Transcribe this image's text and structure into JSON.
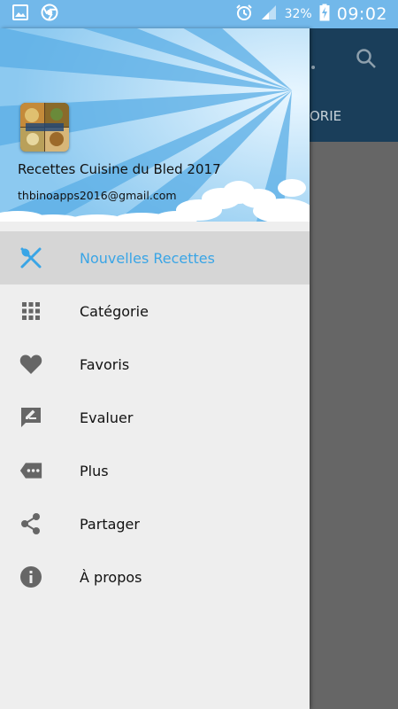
{
  "status_bar": {
    "battery_percent": "32%",
    "time": "09:02",
    "icons": [
      "image-icon",
      "chrome-icon",
      "alarm-icon",
      "signal-icon",
      "battery-charging-icon"
    ]
  },
  "background_app": {
    "tab_fragment": "ORIE"
  },
  "drawer": {
    "header": {
      "app_name": "Recettes Cuisine du Bled 2017",
      "email": "thbinoapps2016@gmail.com"
    },
    "items": [
      {
        "label": "Nouvelles Recettes",
        "icon": "fork-spoon-icon",
        "active": true
      },
      {
        "label": "Catégorie",
        "icon": "grid-icon",
        "active": false
      },
      {
        "label": "Favoris",
        "icon": "heart-icon",
        "active": false
      },
      {
        "label": "Evaluer",
        "icon": "rate-review-icon",
        "active": false
      },
      {
        "label": "Plus",
        "icon": "more-tag-icon",
        "active": false
      },
      {
        "label": "Partager",
        "icon": "share-icon",
        "active": false
      },
      {
        "label": "À propos",
        "icon": "info-icon",
        "active": false
      }
    ]
  },
  "colors": {
    "status_bar": "#72b8ea",
    "accent": "#3aa5e6",
    "icon_gray": "#666666",
    "toolbar": "#1a3e5a"
  }
}
